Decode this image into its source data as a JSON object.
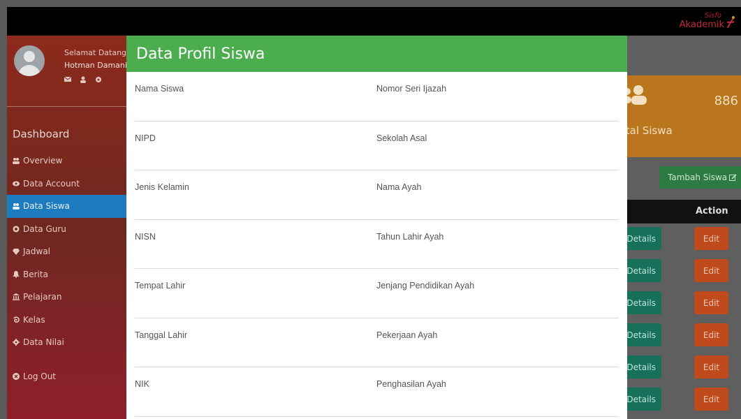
{
  "logo": {
    "line1": "Sisfo",
    "line2": "Akademik"
  },
  "sidebar": {
    "greeting": "Selamat Datang",
    "user_name": "Hotman Damanik",
    "section_title": "Dashboard",
    "items": [
      {
        "label": "Overview",
        "icon": "users-icon"
      },
      {
        "label": "Data Account",
        "icon": "eye-icon"
      },
      {
        "label": "Data Siswa",
        "icon": "users-icon",
        "active": true
      },
      {
        "label": "Data Guru",
        "icon": "circle-icon"
      },
      {
        "label": "Jadwal",
        "icon": "diamond-icon"
      },
      {
        "label": "Berita",
        "icon": "bell-icon"
      },
      {
        "label": "Pelajaran",
        "icon": "bank-icon"
      },
      {
        "label": "Kelas",
        "icon": "spiral-icon"
      },
      {
        "label": "Data Nilai",
        "icon": "gear-icon"
      }
    ],
    "logout_label": "Log Out"
  },
  "card": {
    "count": "886",
    "label": "Total Siswa"
  },
  "toolbar": {
    "add_label": "Tambah Siswa"
  },
  "table": {
    "action_header": "Action",
    "details_label": "Details",
    "edit_label": "Edit"
  },
  "modal": {
    "title": "Data Profil Siswa",
    "rows": [
      {
        "left": "Nama Siswa",
        "right": "Nomor Seri Ijazah"
      },
      {
        "left": "NIPD",
        "right": "Sekolah Asal"
      },
      {
        "left": "Jenis Kelamin",
        "right": "Nama Ayah"
      },
      {
        "left": "NISN",
        "right": "Tahun Lahir Ayah"
      },
      {
        "left": "Tempat Lahir",
        "right": "Jenjang Pendidikan Ayah"
      },
      {
        "left": "Tanggal Lahir",
        "right": "Pekerjaan Ayah"
      },
      {
        "left": "NIK",
        "right": "Penghasilan Ayah"
      }
    ]
  }
}
